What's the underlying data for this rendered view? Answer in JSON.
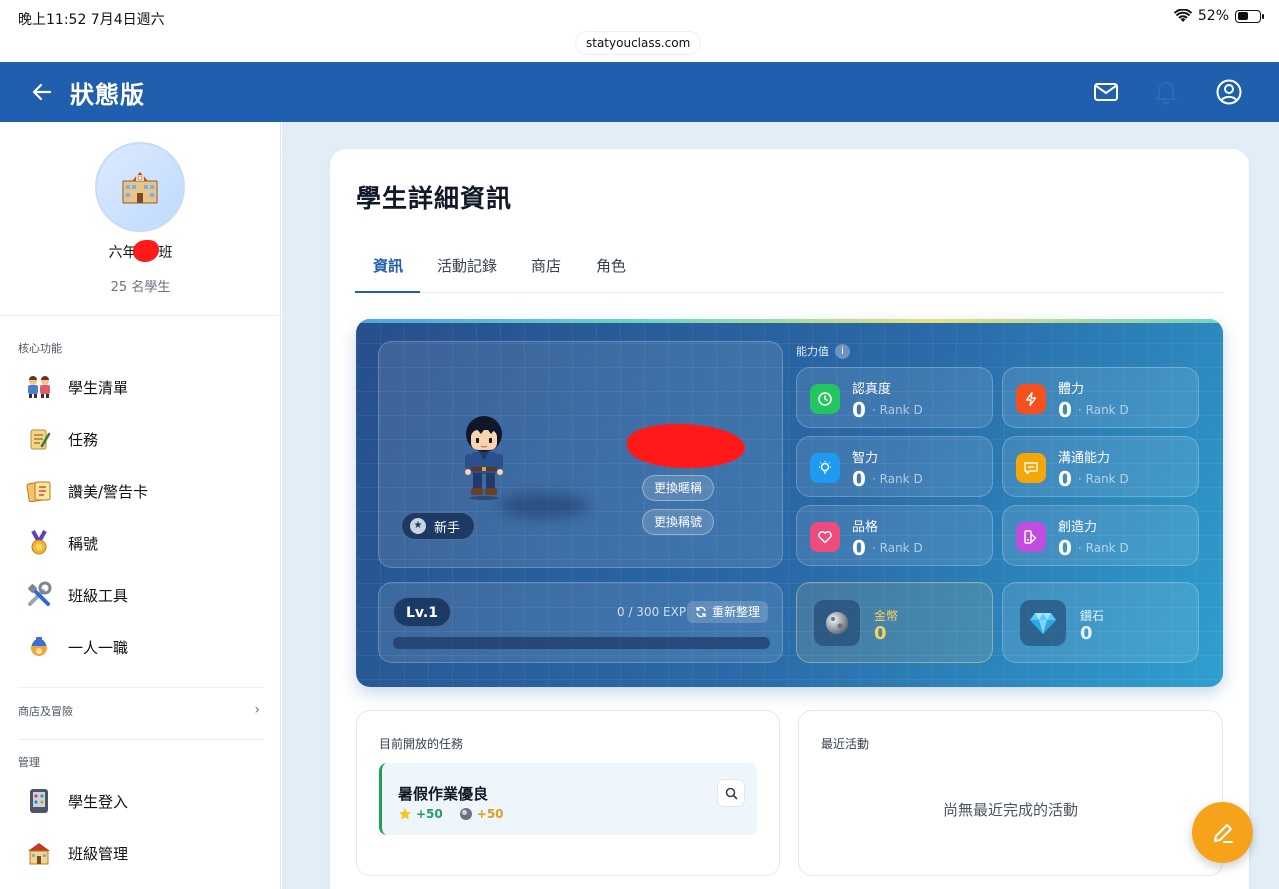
{
  "status_bar": {
    "time": "晚上11:52 7月4日週六",
    "battery": "52%",
    "battery_level": 0.52,
    "url": "statyouclass.com"
  },
  "app_bar": {
    "title": "狀態版"
  },
  "sidebar": {
    "class_name_prefix": "六年",
    "class_name_suffix": "班",
    "student_count": "25 名學生",
    "section_core": "核心功能",
    "core_items": [
      {
        "label": "學生清單",
        "icon": "students-icon"
      },
      {
        "label": "任務",
        "icon": "scroll-icon"
      },
      {
        "label": "讚美/警告卡",
        "icon": "cards-icon"
      },
      {
        "label": "稱號",
        "icon": "medal-icon"
      },
      {
        "label": "班級工具",
        "icon": "tools-icon"
      },
      {
        "label": "一人一職",
        "icon": "job-icon"
      }
    ],
    "section_shop": "商店及冒險",
    "section_manage": "管理",
    "manage_items": [
      {
        "label": "學生登入",
        "icon": "login-icon"
      },
      {
        "label": "班級管理",
        "icon": "school-icon"
      }
    ]
  },
  "main": {
    "title": "學生詳細資訊",
    "tabs": [
      "資訊",
      "活動記錄",
      "商店",
      "角色"
    ],
    "active_tab": 0,
    "character": {
      "btn_change_nickname": "更換暱稱",
      "btn_change_title": "更換稱號",
      "rank_title": "新手",
      "level": "Lv.1",
      "exp": "0 / 300 EXP",
      "exp_progress": 0.0,
      "btn_refresh": "重新整理"
    },
    "abilities_label": "能力值",
    "rank_label": "Rank",
    "stats": [
      {
        "name": "認真度",
        "value": "0",
        "rank": "D",
        "color": "#22c55e",
        "icon": "clock-icon"
      },
      {
        "name": "體力",
        "value": "0",
        "rank": "D",
        "color": "#f4511e",
        "icon": "bolt-icon"
      },
      {
        "name": "智力",
        "value": "0",
        "rank": "D",
        "color": "#1e9af0",
        "icon": "bulb-icon"
      },
      {
        "name": "溝通能力",
        "value": "0",
        "rank": "D",
        "color": "#f5a70a",
        "icon": "chat-icon"
      },
      {
        "name": "品格",
        "value": "0",
        "rank": "D",
        "color": "#ec4c7e",
        "icon": "heart-icon"
      },
      {
        "name": "創造力",
        "value": "0",
        "rank": "D",
        "color": "#c04de0",
        "icon": "palette-icon"
      }
    ],
    "currencies": [
      {
        "name": "金幣",
        "value": "0",
        "color": "#f5d35a",
        "icon": "coin-icon"
      },
      {
        "name": "鑽石",
        "value": "0",
        "color": "#bfe8ff",
        "icon": "diamond-icon"
      }
    ],
    "open_quests": {
      "title": "目前開放的任務",
      "items": [
        {
          "name": "暑假作業優良",
          "exp_reward": "+50",
          "coin_reward": "+50"
        }
      ]
    },
    "recent_activity": {
      "title": "最近活動",
      "empty": "尚無最近完成的活動"
    }
  },
  "colors": {
    "primary": "#1f5fae",
    "page_bg": "#e1eef8",
    "fab": "#f7a21b"
  }
}
